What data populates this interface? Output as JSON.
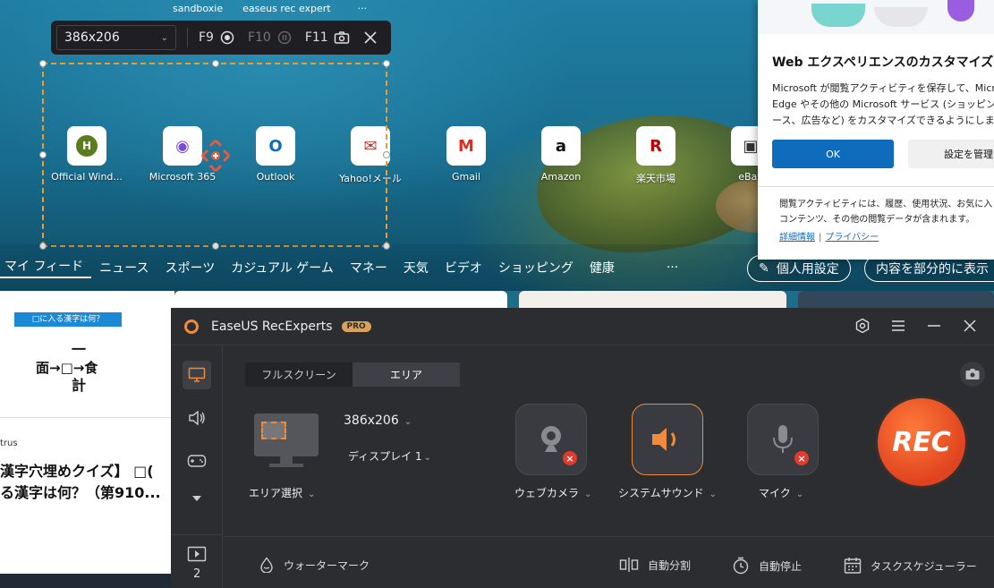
{
  "browser": {
    "top_tabs": [
      "sandboxie",
      "easeus rec expert",
      "···"
    ],
    "shortcuts": [
      {
        "label": "Official Wind...",
        "icon": "h-logo-icon",
        "glyph": "H",
        "color": "#5a7d1e"
      },
      {
        "label": "Microsoft 365",
        "icon": "microsoft365-icon",
        "glyph": "◉",
        "color": "#7a4bd6"
      },
      {
        "label": "Outlook",
        "icon": "outlook-icon",
        "glyph": "O",
        "color": "#0f6cbd"
      },
      {
        "label": "Yahoo!メール",
        "icon": "yahoo-mail-icon",
        "glyph": "✉",
        "color": "#c0392b"
      },
      {
        "label": "Gmail",
        "icon": "gmail-icon",
        "glyph": "M",
        "color": "#d93025"
      },
      {
        "label": "Amazon",
        "icon": "amazon-icon",
        "glyph": "a",
        "color": "#111111"
      },
      {
        "label": "楽天市場",
        "icon": "rakuten-icon",
        "glyph": "R",
        "color": "#bf0000"
      },
      {
        "label": "eBay",
        "icon": "ebay-icon",
        "glyph": "▣",
        "color": "#333333"
      }
    ],
    "nav": [
      "マイ フィード",
      "ニュース",
      "スポーツ",
      "カジュアル ゲーム",
      "マネー",
      "天気",
      "ビデオ",
      "ショッピング",
      "健康",
      "···"
    ],
    "personalize_label": "個人用設定",
    "partial_label": "内容を部分的に表示",
    "news": {
      "banner": "□に入る漢字は何？",
      "quiz_top": "一",
      "quiz_mid": "面→□→食",
      "quiz_bot": "計",
      "source": "trus",
      "headline1": "漢字穴埋めクイズ】 □(",
      "headline2": "る漢字は何？（第910..."
    }
  },
  "popup": {
    "title": "Web エクスペリエンスのカスタマイズ",
    "body": "Microsoft が閲覧アクティビティを保存して、Microsoft Edge やその他の Microsoft サービス (ショッピング、ニュース、広告など) をカスタマイズできるようにします",
    "ok": "OK",
    "manage": "設定を管理",
    "note": "閲覧アクティビティには、履歴、使用状況、お気に入り、コンテンツ、その他の閲覧データが含まれます。",
    "link_details": "詳細情報",
    "link_privacy": "プライバシー"
  },
  "toolbar": {
    "size": "386x206",
    "f9": "F9",
    "f10": "F10",
    "f11": "F11"
  },
  "app": {
    "title": "EaseUS RecExperts",
    "badge": "PRO",
    "tabs": [
      "フルスクリーン",
      "エリア"
    ],
    "area_size": "386x206",
    "display": "ディスプレイ 1",
    "area_select": "エリア選択",
    "webcam": "ウェブカメラ",
    "system_sound": "システムサウンド",
    "mic": "マイク",
    "rec": "REC",
    "recordings_count": "2",
    "watermark": "ウォーターマーク",
    "auto_split": "自動分割",
    "auto_stop": "自動停止",
    "scheduler": "タスクスケジューラー"
  },
  "colors": {
    "accent": "#f08b3d",
    "rec": "#e0431f",
    "edge_blue": "#0f6cbd"
  }
}
